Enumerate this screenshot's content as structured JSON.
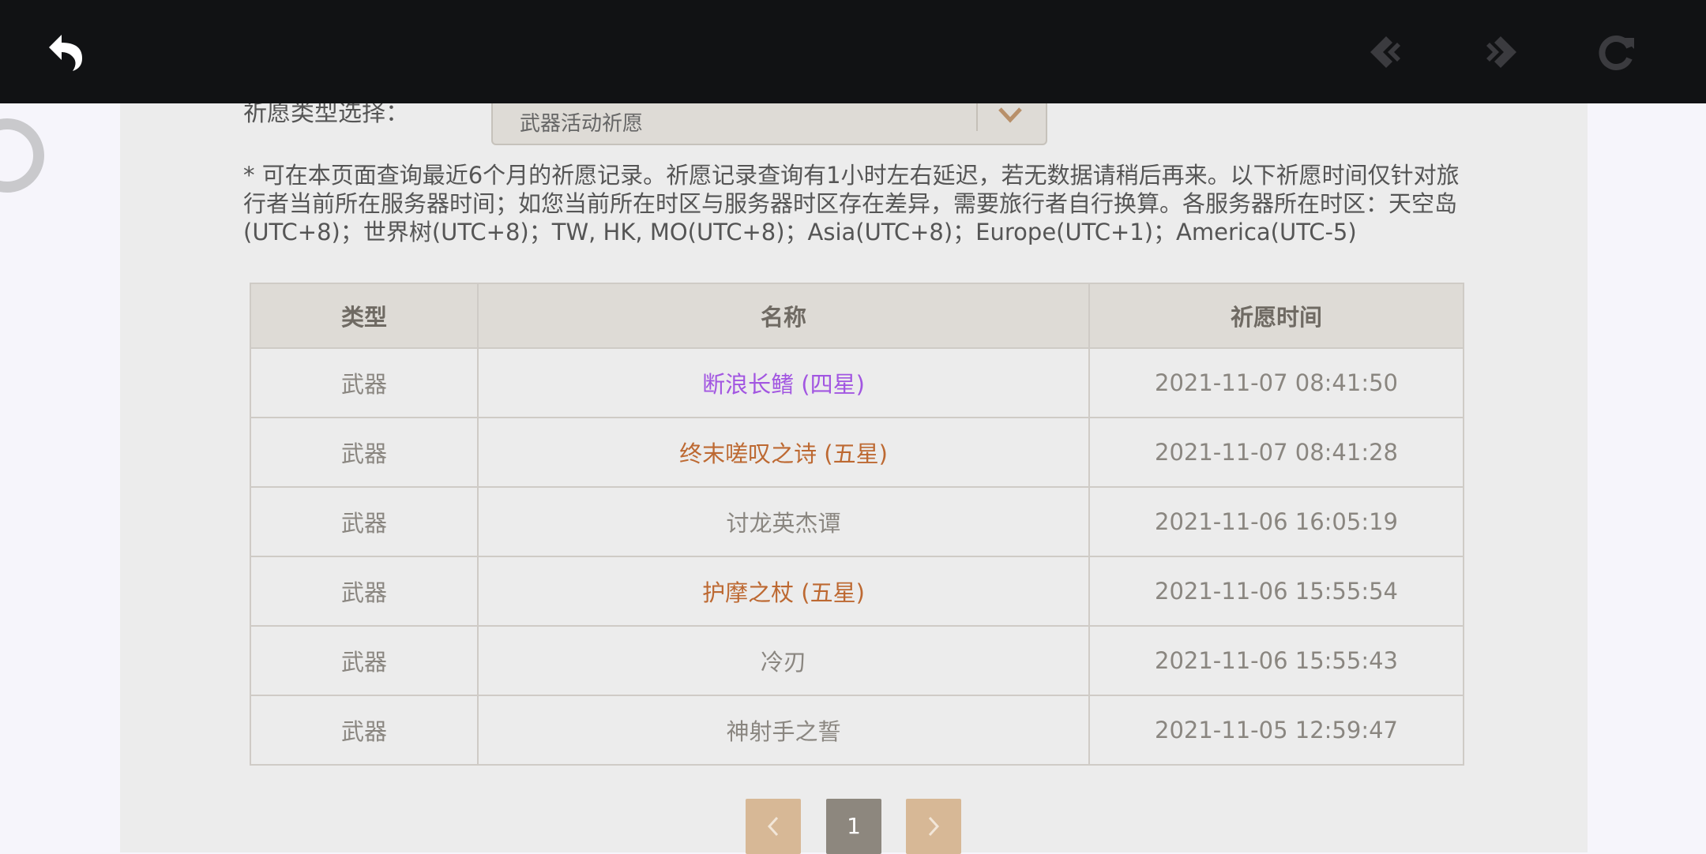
{
  "topbar": {
    "back_icon": "undo-arrow-icon",
    "prev_icon": "diamond-left-icon",
    "next_icon": "diamond-right-icon",
    "reload_icon": "reload-icon"
  },
  "filter": {
    "label": "祈愿类型选择：",
    "value": "武器活动祈愿"
  },
  "notice": "* 可在本页面查询最近6个月的祈愿记录。祈愿记录查询有1小时左右延迟，若无数据请稍后再来。以下祈愿时间仅针对旅行者当前所在服务器时间；如您当前所在时区与服务器时区存在差异，需要旅行者自行换算。各服务器所在时区：天空岛(UTC+8)；世界树(UTC+8)；TW, HK, MO(UTC+8)；Asia(UTC+8)；Europe(UTC+1)；America(UTC-5)",
  "table": {
    "headers": [
      "类型",
      "名称",
      "祈愿时间"
    ],
    "rows": [
      {
        "type": "武器",
        "name": "断浪长鳍 (四星)",
        "time": "2021-11-07 08:41:50",
        "rarity": 4
      },
      {
        "type": "武器",
        "name": "终末嗟叹之诗 (五星)",
        "time": "2021-11-07 08:41:28",
        "rarity": 5
      },
      {
        "type": "武器",
        "name": "讨龙英杰谭",
        "time": "2021-11-06 16:05:19",
        "rarity": 3
      },
      {
        "type": "武器",
        "name": "护摩之杖 (五星)",
        "time": "2021-11-06 15:55:54",
        "rarity": 5
      },
      {
        "type": "武器",
        "name": "冷刃",
        "time": "2021-11-06 15:55:43",
        "rarity": 3
      },
      {
        "type": "武器",
        "name": "神射手之誓",
        "time": "2021-11-05 12:59:47",
        "rarity": 3
      }
    ]
  },
  "pagination": {
    "current_page": "1",
    "prev_icon": "chevron-left-icon",
    "next_icon": "chevron-right-icon"
  },
  "colors": {
    "four_star": "#a256e1",
    "five_star": "#bd6932",
    "three_star": "#8a8680"
  }
}
